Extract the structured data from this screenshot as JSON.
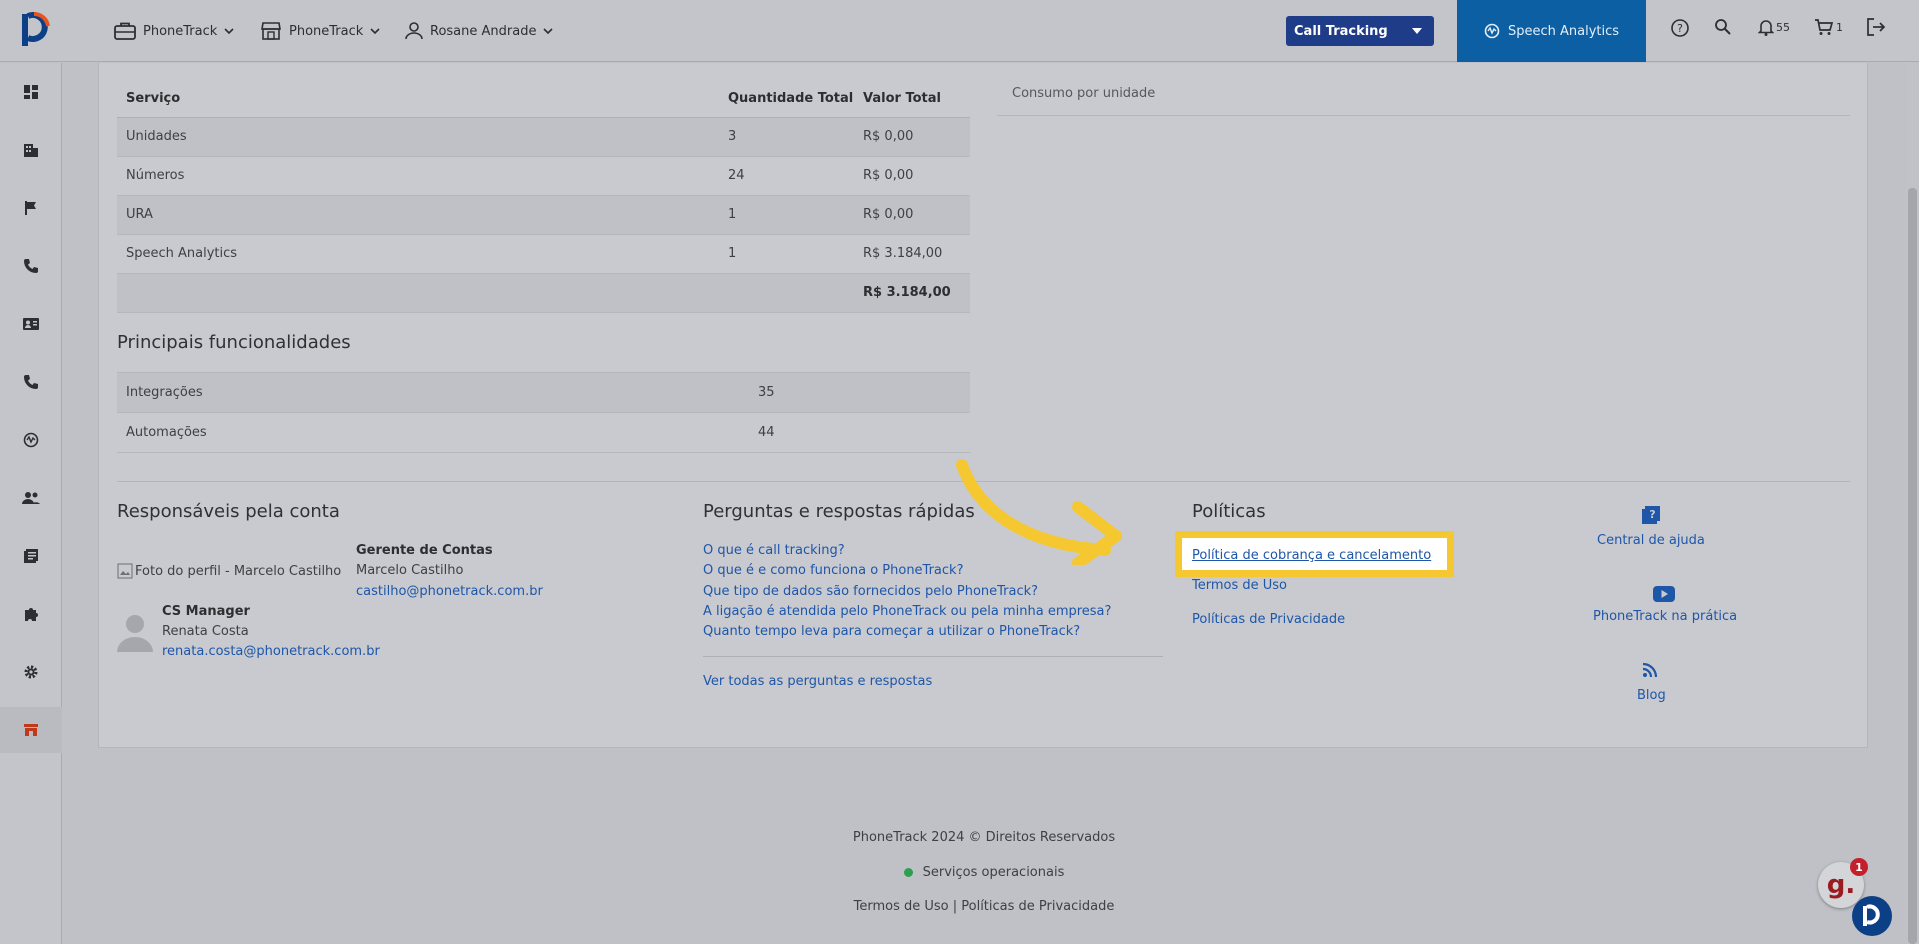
{
  "topbar": {
    "nav": [
      {
        "label": "PhoneTrack",
        "icon": "briefcase-icon"
      },
      {
        "label": "PhoneTrack",
        "icon": "store-icon"
      },
      {
        "label": "Rosane Andrade",
        "icon": "user-icon"
      }
    ],
    "product_select": "Call Tracking",
    "speech_button": "Speech Analytics",
    "notifications_count": "55",
    "cart_count": "1"
  },
  "services_table": {
    "headers": [
      "Serviço",
      "Quantidade Total",
      "Valor Total"
    ],
    "rows": [
      {
        "service": "Unidades",
        "qty": "3",
        "value": "R$ 0,00"
      },
      {
        "service": "Números",
        "qty": "24",
        "value": "R$ 0,00"
      },
      {
        "service": "URA",
        "qty": "1",
        "value": "R$ 0,00"
      },
      {
        "service": "Speech Analytics",
        "qty": "1",
        "value": "R$ 3.184,00"
      }
    ],
    "total": "R$ 3.184,00"
  },
  "consumo_header": "Consumo por unidade",
  "features": {
    "title": "Principais funcionalidades",
    "rows": [
      {
        "name": "Integrações",
        "count": "35"
      },
      {
        "name": "Automações",
        "count": "44"
      }
    ]
  },
  "responsaveis": {
    "title": "Responsáveis pela conta",
    "manager_photo_alt": "Foto do perfil - Marcelo Castilho",
    "manager_role": "Gerente de Contas",
    "manager_name": "Marcelo Castilho",
    "manager_email": "castilho@phonetrack.com.br",
    "cs_role": "CS Manager",
    "cs_name": "Renata Costa",
    "cs_email": "renata.costa@phonetrack.com.br"
  },
  "faq": {
    "title": "Perguntas e respostas rápidas",
    "items": [
      "O que é call tracking?",
      "O que é e como funciona o PhoneTrack?",
      "Que tipo de dados são fornecidos pelo PhoneTrack?",
      "A ligação é atendida pelo PhoneTrack ou pela minha empresa?",
      "Quanto tempo leva para começar a utilizar o PhoneTrack?"
    ],
    "see_all": "Ver todas as perguntas e respostas"
  },
  "politicas": {
    "title": "Políticas",
    "billing": "Política de cobrança e cancelamento",
    "terms": "Termos de Uso",
    "privacy": "Políticas de Privacidade"
  },
  "help": {
    "central": "Central de ajuda",
    "pratica": "PhoneTrack na prática",
    "blog": "Blog"
  },
  "footer": {
    "copyright": "PhoneTrack 2024 © Direitos Reservados",
    "status": "Serviços operacionais",
    "links": "Termos de Uso | Políticas de Privacidade"
  },
  "chat_badge": {
    "letter": "g.",
    "count": "1"
  },
  "colors": {
    "highlight": "#f5c832",
    "arrow": "#f5c832",
    "speech": "#0c5fa3",
    "call_tracking": "#1f3c88",
    "link": "#1e56a8"
  }
}
